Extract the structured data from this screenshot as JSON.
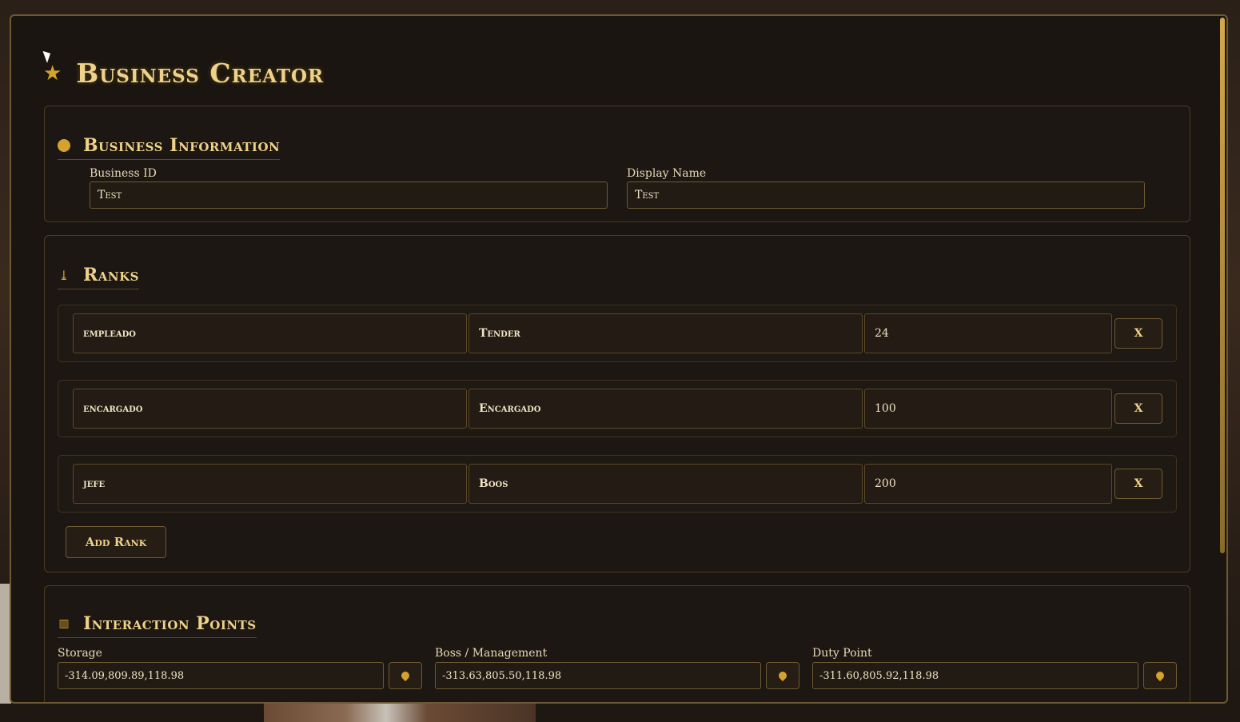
{
  "header": {
    "title": "Business Creator",
    "icon": "star-icon"
  },
  "business_info": {
    "title": "Business Information",
    "icon": "dot-icon",
    "id_label": "Business ID",
    "id_value": "Test",
    "display_label": "Display Name",
    "display_value": "Test"
  },
  "ranks": {
    "title": "Ranks",
    "icon": "download-icon",
    "items": [
      {
        "name": "empleado",
        "label": "Tender",
        "value": "24",
        "remove": "X"
      },
      {
        "name": "encargado",
        "label": "Encargado",
        "value": "100",
        "remove": "X"
      },
      {
        "name": "jefe",
        "label": "Boos",
        "value": "200",
        "remove": "X"
      }
    ],
    "add_label": "Add Rank"
  },
  "interaction_points": {
    "title": "Interaction Points",
    "icon": "map-icon",
    "items": [
      {
        "label": "Storage",
        "value": "-314.09,809.89,118.98"
      },
      {
        "label": "Boss / Management",
        "value": "-313.63,805.50,118.98"
      },
      {
        "label": "Duty Point",
        "value": "-311.60,805.92,118.98"
      }
    ]
  },
  "colors": {
    "accent": "#d4a32c",
    "border": "#6e5a32",
    "panel": "#1a1510"
  }
}
